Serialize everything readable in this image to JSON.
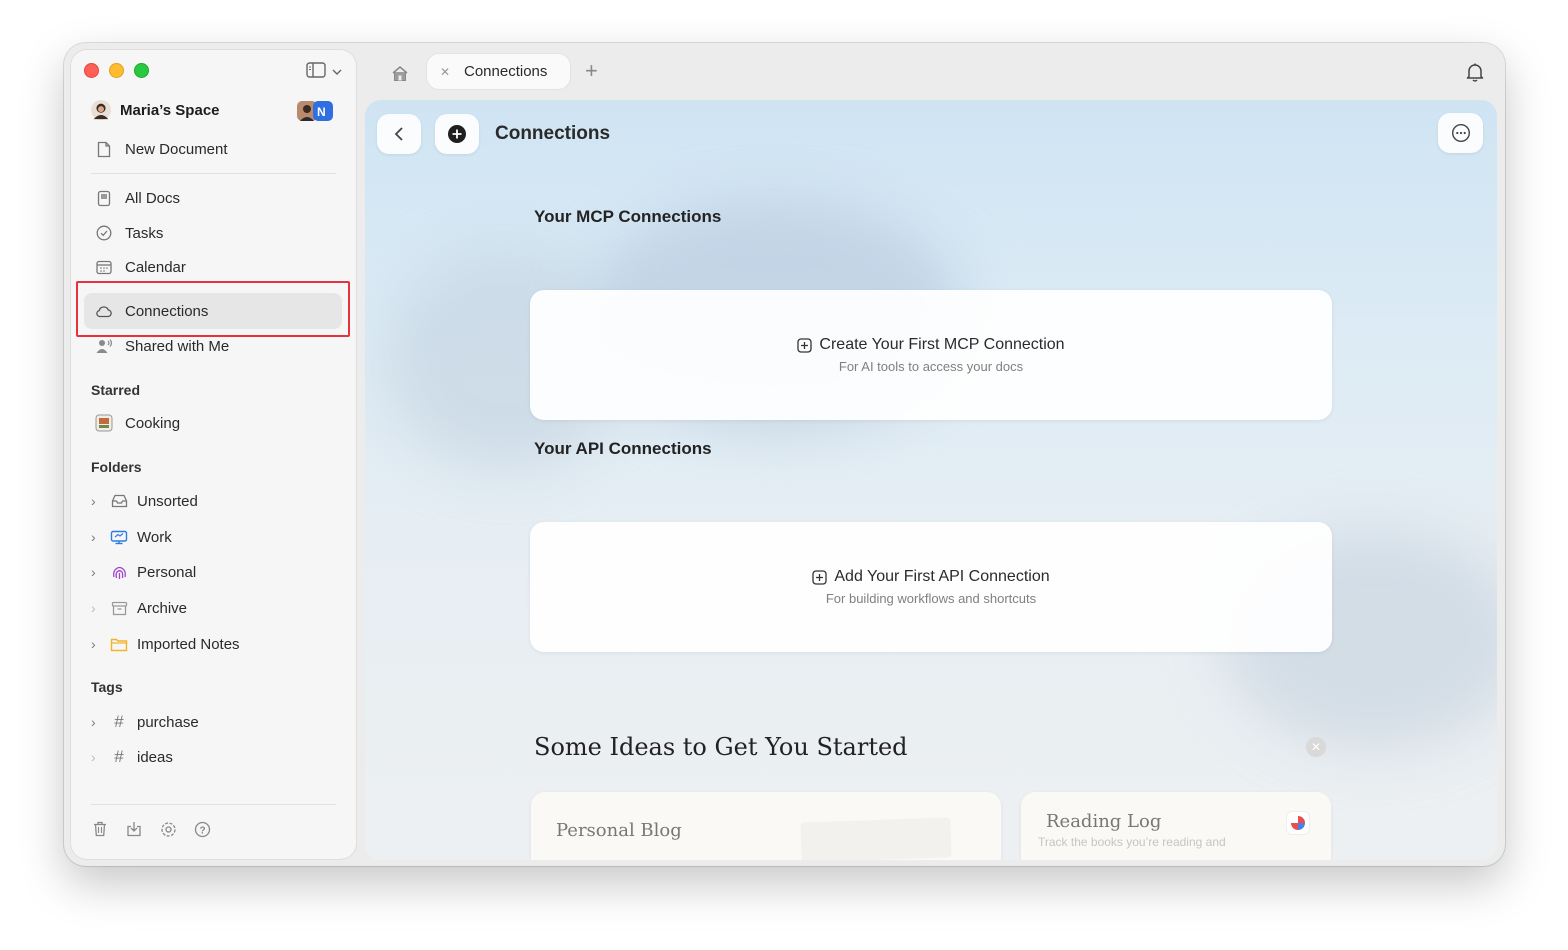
{
  "sidebar": {
    "workspace_name": "Maria’s Space",
    "new_document": "New Document",
    "nav": [
      {
        "label": "All Docs",
        "icon": "doc-icon"
      },
      {
        "label": "Tasks",
        "icon": "check-circle-icon"
      },
      {
        "label": "Calendar",
        "icon": "calendar-icon"
      },
      {
        "label": "Connections",
        "icon": "cloud-icon",
        "selected": true
      },
      {
        "label": "Shared with Me",
        "icon": "shared-user-icon"
      }
    ],
    "starred_heading": "Starred",
    "starred": [
      {
        "label": "Cooking",
        "icon": "cookbook-icon"
      }
    ],
    "folders_heading": "Folders",
    "folders": [
      {
        "label": "Unsorted",
        "icon": "inbox-icon"
      },
      {
        "label": "Work",
        "icon": "monitor-icon"
      },
      {
        "label": "Personal",
        "icon": "fingerprint-icon"
      },
      {
        "label": "Archive",
        "icon": "archive-icon"
      },
      {
        "label": "Imported Notes",
        "icon": "folder-icon"
      }
    ],
    "tags_heading": "Tags",
    "tags": [
      {
        "label": "purchase"
      },
      {
        "label": "ideas"
      }
    ],
    "bottom_icons": [
      "trash-icon",
      "import-icon",
      "settings-icon",
      "help-icon"
    ]
  },
  "tabs": [
    {
      "label": "Connections",
      "active": true
    }
  ],
  "main": {
    "title": "Connections",
    "mcp_heading": "Your MCP Connections",
    "mcp_cta": "Create Your First MCP Connection",
    "mcp_sub": "For AI tools to access your docs",
    "api_heading": "Your API Connections",
    "api_cta": "Add Your First API Connection",
    "api_sub": "For building workflows and shortcuts",
    "ideas_heading": "Some Ideas to Get You Started",
    "ideas": [
      {
        "title": "Personal Blog",
        "desc": ""
      },
      {
        "title": "Reading Log",
        "desc": "Track the books you’re reading and"
      }
    ]
  },
  "colors": {
    "accent_red": "#e5323e",
    "traffic_red": "#fe5f57",
    "traffic_yellow": "#febc2e",
    "traffic_green": "#28c840"
  }
}
